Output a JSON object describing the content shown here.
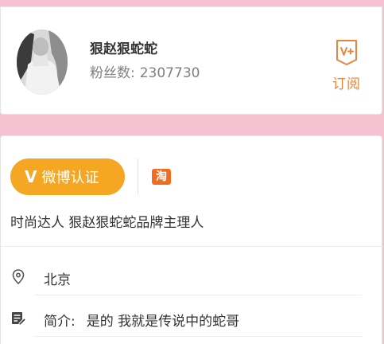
{
  "profile": {
    "username": "狠赵狠蛇蛇",
    "fans_label": "粉丝数:",
    "fans_count": "2307730",
    "subscribe_label": "订阅"
  },
  "verification": {
    "badge_label": "微博认证",
    "badge_mark": "V",
    "taobao_glyph": "淘",
    "description": "时尚达人 狠赵狠蛇蛇品牌主理人"
  },
  "info": {
    "location": "北京",
    "bio_label": "简介:",
    "bio_text": "是的 我就是传说中的蛇哥"
  },
  "colors": {
    "accent_orange": "#e8843c",
    "badge_orange": "#f5a623",
    "taobao_orange": "#f36b1f",
    "page_pink": "#f6c2d1"
  },
  "icons": {
    "subscribe": "v-plus-icon",
    "location": "location-pin-icon",
    "bio": "edit-note-icon",
    "taobao": "taobao-icon"
  }
}
